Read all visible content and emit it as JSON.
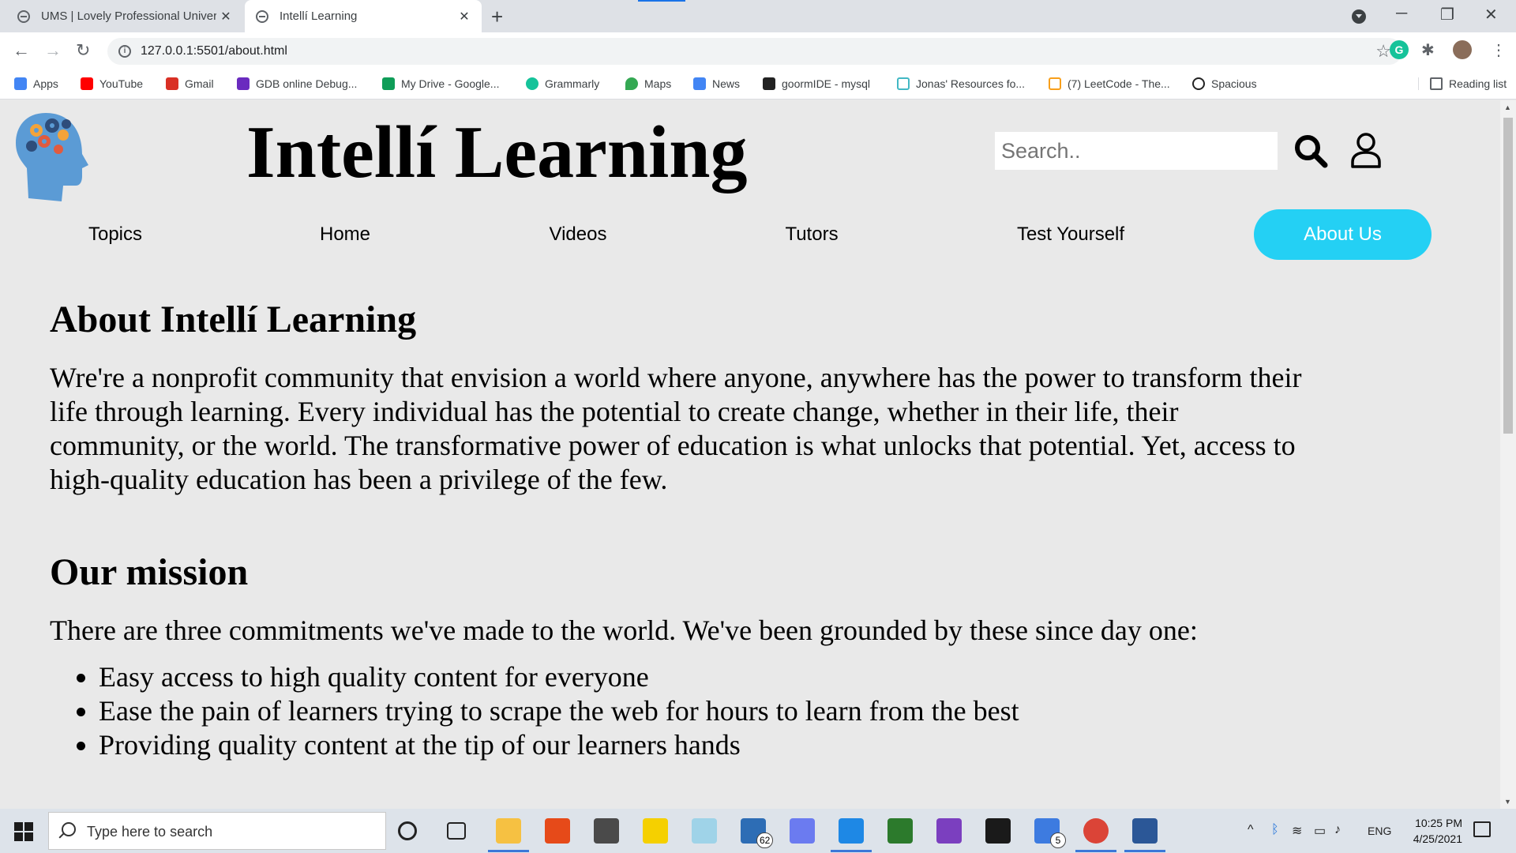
{
  "browser": {
    "tabs": [
      {
        "title": "UMS | Lovely Professional University",
        "active": false
      },
      {
        "title": "Intellí Learning",
        "active": true
      }
    ],
    "url": "127.0.0.1:5501/about.html",
    "bookmarks": [
      {
        "label": "Apps",
        "icon": "apps-grid-icon",
        "color": "#4285f4"
      },
      {
        "label": "YouTube",
        "icon": "youtube-icon",
        "color": "#ff0000"
      },
      {
        "label": "Gmail",
        "icon": "gmail-icon",
        "color": "#d93025"
      },
      {
        "label": "GDB online Debug...",
        "icon": "gdb-icon",
        "color": "#6a2bbf"
      },
      {
        "label": "My Drive - Google...",
        "icon": "google-drive-icon",
        "color": "#0f9d58"
      },
      {
        "label": "Grammarly",
        "icon": "grammarly-icon",
        "color": "#15c39a"
      },
      {
        "label": "Maps",
        "icon": "maps-pin-icon",
        "color": "#34a853"
      },
      {
        "label": "News",
        "icon": "google-news-icon",
        "color": "#4285f4"
      },
      {
        "label": "goormIDE - mysql",
        "icon": "goorm-icon",
        "color": "#222222"
      },
      {
        "label": "Jonas' Resources fo...",
        "icon": "heart-icon",
        "color": "#42b8c4"
      },
      {
        "label": "(7) LeetCode - The...",
        "icon": "leetcode-icon",
        "color": "#f89f1b"
      },
      {
        "label": "Spacious",
        "icon": "spacious-icon",
        "color": "#222222"
      }
    ],
    "reading_list": "Reading list"
  },
  "site": {
    "brand": "Intellí Learning",
    "search_placeholder": "Search..",
    "nav": [
      {
        "label": "Topics"
      },
      {
        "label": "Home"
      },
      {
        "label": "Videos"
      },
      {
        "label": "Tutors"
      },
      {
        "label": "Test Yourself"
      },
      {
        "label": "About Us",
        "active": true
      }
    ],
    "accent_color": "#24d0f4"
  },
  "about": {
    "heading": "About Intellí Learning",
    "paragraph": "Wre're a nonprofit community that envision a world where anyone, anywhere has the power to transform their life through learning. Every individual has the potential to create change, whether in their life, their community, or the world. The transformative power of education is what unlocks that potential. Yet, access to high-quality education has been a privilege of the few."
  },
  "mission": {
    "heading": "Our mission",
    "intro": "There are three commitments we've made to the world. We've been grounded by these since day one:",
    "items": [
      "Easy access to high quality content for everyone",
      "Ease the pain of learners trying to scrape the web for hours to learn from the best",
      "Providing quality content at the tip of our learners hands"
    ]
  },
  "taskbar": {
    "search_placeholder": "Type here to search",
    "mail_badge": "62",
    "todo_badge": "5",
    "language": "ENG",
    "time": "10:25 PM",
    "date": "4/25/2021"
  }
}
